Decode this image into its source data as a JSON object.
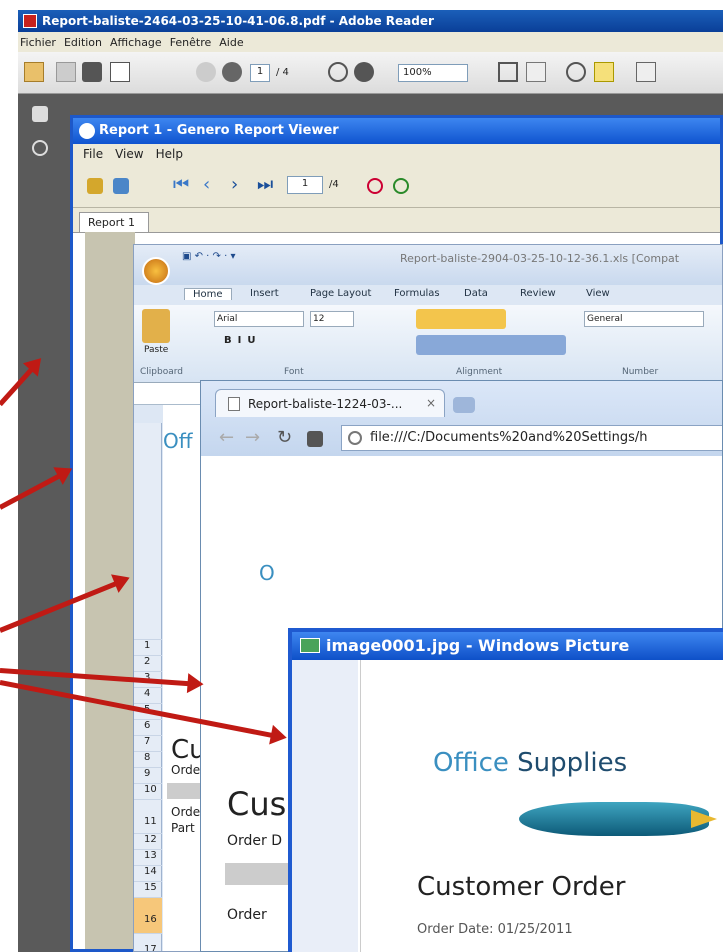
{
  "adobe": {
    "title": "Report-baliste-2464-03-25-10-41-06.8.pdf - Adobe Reader",
    "menu": [
      "Fichier",
      "Edition",
      "Affichage",
      "Fenêtre",
      "Aide"
    ],
    "page": "1",
    "pages": "/ 4",
    "zoom": "100%"
  },
  "genero": {
    "title": "Report 1 - Genero Report Viewer",
    "menu": [
      "File",
      "View",
      "Help"
    ],
    "page": "1",
    "pages": "/4",
    "tab": "Report 1"
  },
  "excel": {
    "title": "Report-baliste-2904-03-25-10-12-36.1.xls [Compat",
    "tabs": [
      "Home",
      "Insert",
      "Page Layout",
      "Formulas",
      "Data",
      "Review",
      "View"
    ],
    "font": "Arial",
    "size": "12",
    "number_format": "General",
    "paste": "Paste",
    "groups": [
      "Clipboard",
      "Font",
      "Alignment",
      "Number"
    ],
    "rows": [
      "1",
      "2",
      "3",
      "4",
      "5",
      "6",
      "7",
      "8",
      "9",
      "10",
      "11",
      "12",
      "13",
      "14",
      "15",
      "16",
      "17"
    ],
    "cells": {
      "logo": "Off",
      "r11": "Cu",
      "r12": "Orde",
      "r14": "Orde",
      "r15": "Part"
    }
  },
  "chrome": {
    "tab": "Report-baliste-1224-03-...",
    "url": "file:///C:/Documents%20and%20Settings/h",
    "logo": "O",
    "heading": "Cus",
    "line1": "Order D",
    "line2": "Order"
  },
  "viewer": {
    "title": "image0001.jpg - Windows Picture",
    "logo_a": "Office",
    "logo_b": " Supplies",
    "heading": "Customer Order",
    "date": "Order Date: 01/25/2011"
  },
  "colors": {
    "arrow": "#c01a14",
    "xp_blue": "#0f53cf"
  }
}
